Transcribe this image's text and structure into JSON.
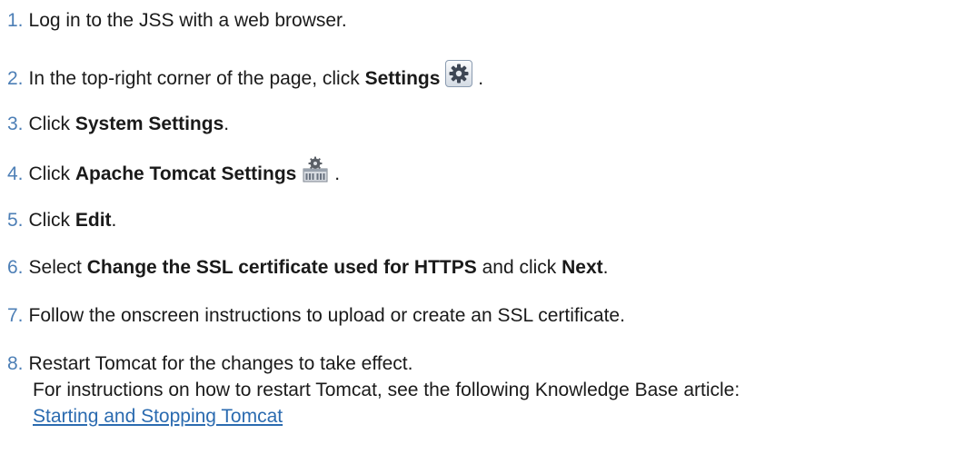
{
  "steps": [
    {
      "num": "1.",
      "text": "Log in to the JSS with a web browser."
    },
    {
      "num": "2.",
      "pre": "In the top-right corner of the page, click ",
      "bold": "Settings",
      "post": " .",
      "icon": "settings-gear-icon"
    },
    {
      "num": "3.",
      "pre": "Click ",
      "bold": "System Settings",
      "post": "."
    },
    {
      "num": "4.",
      "pre": "Click ",
      "bold": "Apache Tomcat Settings",
      "post": " .",
      "icon": "server-gear-icon"
    },
    {
      "num": "5.",
      "pre": "Click ",
      "bold": "Edit",
      "post": "."
    },
    {
      "num": "6.",
      "pre": "Select ",
      "bold": "Change the SSL certificate used for HTTPS",
      "mid": " and click ",
      "bold2": "Next",
      "post": "."
    },
    {
      "num": "7.",
      "text": "Follow the onscreen instructions to upload or create an SSL certificate."
    },
    {
      "num": "8.",
      "text": "Restart Tomcat for the changes to take effect.",
      "line2": "For instructions on how to restart Tomcat, see the following Knowledge Base article:",
      "link": "Starting and Stopping Tomcat"
    }
  ]
}
